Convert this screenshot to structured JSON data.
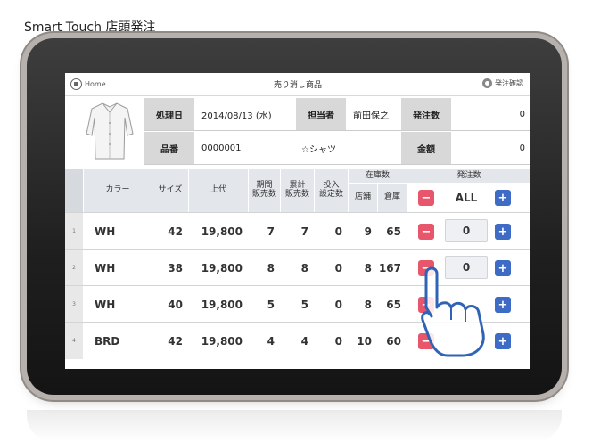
{
  "caption": "Smart Touch 店頭発注",
  "topbar": {
    "home_label": "Home",
    "title": "売り消し商品",
    "confirm_label": "発注確認"
  },
  "info": {
    "processing_date_label": "処理日",
    "processing_date": "2014/08/13 (水)",
    "staff_label": "担当者",
    "staff_name": "前田保之",
    "order_qty_label": "発注数",
    "order_qty_value": "0",
    "item_no_label": "品番",
    "item_no": "0000001",
    "item_name": "☆シャツ",
    "amount_label": "金額",
    "amount_value": "0"
  },
  "table": {
    "headers": {
      "color": "カラー",
      "size": "サイズ",
      "price": "上代",
      "period_sales": "期間\n販売数",
      "cumulative_sales": "累計\n販売数",
      "input_setting": "投入\n設定数",
      "stock": "在庫数",
      "store": "店舗",
      "warehouse": "倉庫",
      "order_qty": "発注数",
      "all_label": "ALL"
    },
    "rows": [
      {
        "index": "1",
        "color": "WH",
        "size": "42",
        "price": "19,800",
        "period": "7",
        "cumulative": "7",
        "setting": "0",
        "store": "9",
        "warehouse": "65",
        "qty": "0"
      },
      {
        "index": "2",
        "color": "WH",
        "size": "38",
        "price": "19,800",
        "period": "8",
        "cumulative": "8",
        "setting": "0",
        "store": "8",
        "warehouse": "167",
        "qty": "0"
      },
      {
        "index": "3",
        "color": "WH",
        "size": "40",
        "price": "19,800",
        "period": "5",
        "cumulative": "5",
        "setting": "0",
        "store": "8",
        "warehouse": "65",
        "qty": ""
      },
      {
        "index": "4",
        "color": "BRD",
        "size": "42",
        "price": "19,800",
        "period": "4",
        "cumulative": "4",
        "setting": "0",
        "store": "10",
        "warehouse": "60",
        "qty": ""
      }
    ]
  },
  "colors": {
    "minus": "#e8566c",
    "plus": "#3d6bc6",
    "header_bg": "#e3e6ea",
    "label_bg": "#d8d8d8",
    "hand_stroke": "#2f63b5"
  }
}
